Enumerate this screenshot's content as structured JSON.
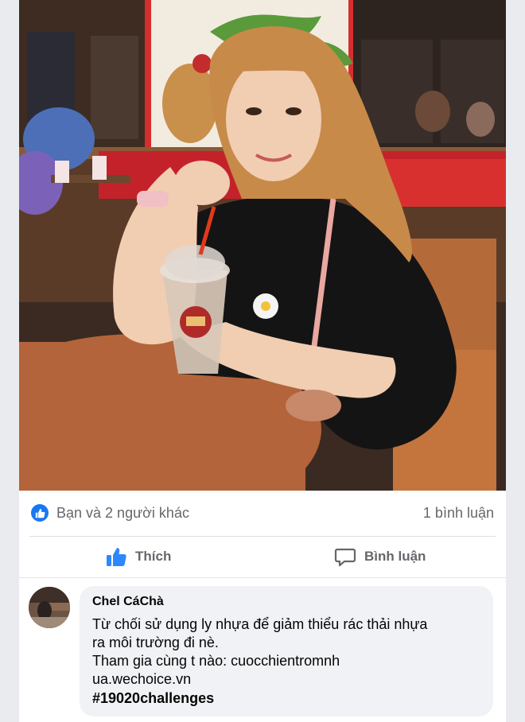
{
  "photo": {
    "description_icon": "photo-image"
  },
  "reactions": {
    "like_icon": "thumbs-up-icon",
    "text": "Bạn và 2 người khác",
    "comment_count": "1 bình luận"
  },
  "actions": {
    "like_label": "Thích",
    "comment_label": "Bình luận"
  },
  "comment": {
    "author": "Chel CáChà",
    "lines": [
      "Từ chối sử dụng ly nhựa để giảm thiểu rác thải nhựa",
      "ra môi trường đi nè.",
      "Tham gia cùng t nào: cuocchientromnh",
      "ua.wechoice.vn"
    ],
    "hashtag": "#19020challenges"
  },
  "colors": {
    "accent": "#1877f2",
    "muted_text": "#65676b",
    "bubble_bg": "#f0f2f5"
  }
}
